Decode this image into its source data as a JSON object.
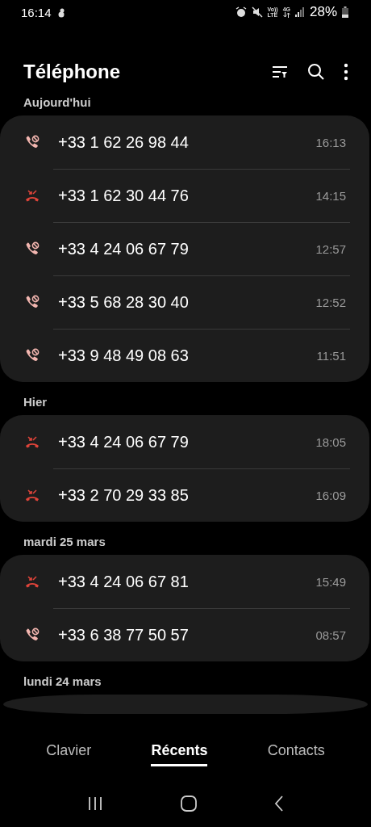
{
  "status_bar": {
    "time": "16:14",
    "volte": [
      "Vo))",
      "LTE"
    ],
    "network": "4G",
    "battery": "28%"
  },
  "header": {
    "title": "Téléphone"
  },
  "sections": [
    {
      "label": "Aujourd'hui",
      "calls": [
        {
          "kind": "blocked",
          "number": "+33 1 62 26 98 44",
          "time": "16:13"
        },
        {
          "kind": "rejected",
          "number": "+33 1 62 30 44 76",
          "time": "14:15"
        },
        {
          "kind": "blocked",
          "number": "+33 4 24 06 67 79",
          "time": "12:57"
        },
        {
          "kind": "blocked",
          "number": "+33 5 68 28 30 40",
          "time": "12:52"
        },
        {
          "kind": "blocked",
          "number": "+33 9 48 49 08 63",
          "time": "11:51"
        }
      ]
    },
    {
      "label": "Hier",
      "calls": [
        {
          "kind": "rejected",
          "number": "+33 4 24 06 67 79",
          "time": "18:05"
        },
        {
          "kind": "rejected",
          "number": "+33 2 70 29 33 85",
          "time": "16:09"
        }
      ]
    },
    {
      "label": "mardi 25 mars",
      "calls": [
        {
          "kind": "rejected",
          "number": "+33 4 24 06 67 81",
          "time": "15:49"
        },
        {
          "kind": "blocked",
          "number": "+33 6 38 77 50 57",
          "time": "08:57"
        }
      ]
    },
    {
      "label": "lundi 24 mars"
    }
  ],
  "tabs": [
    {
      "label": "Clavier",
      "selected": false
    },
    {
      "label": "Récents",
      "selected": true
    },
    {
      "label": "Contacts",
      "selected": false
    }
  ]
}
